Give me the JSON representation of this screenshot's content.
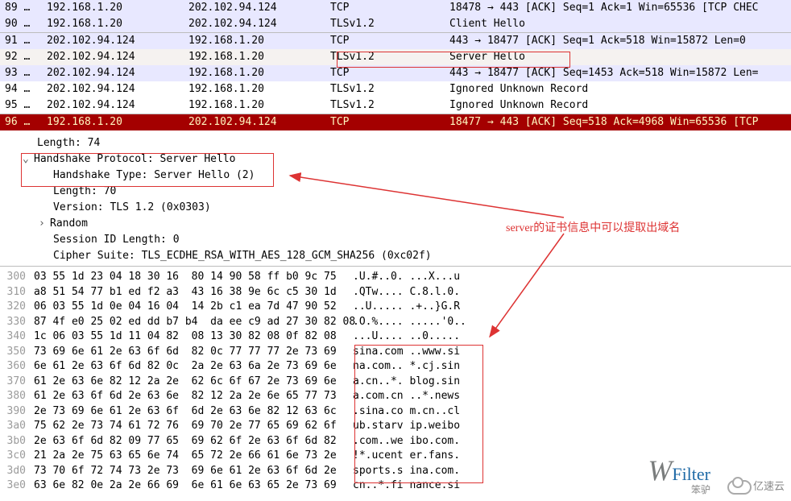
{
  "packets": [
    {
      "no": "89 …",
      "src": "192.168.1.20",
      "dst": "202.102.94.124",
      "prot": "TCP",
      "info": "18478 → 443 [ACK] Seq=1 Ack=1 Win=65536 [TCP CHEC",
      "cls": "row-tcp-lav"
    },
    {
      "no": "90 …",
      "src": "192.168.1.20",
      "dst": "202.102.94.124",
      "prot": "TLSv1.2",
      "info": "Client Hello",
      "cls": "row-tls-lav"
    },
    {
      "no": "91 …",
      "src": "202.102.94.124",
      "dst": "192.168.1.20",
      "prot": "TCP",
      "info": "443 → 18477 [ACK] Seq=1 Ack=518 Win=15872 Len=0",
      "cls": "row-tcp-lav rowsep"
    },
    {
      "no": "92 …",
      "src": "202.102.94.124",
      "dst": "192.168.1.20",
      "prot": "TLSv1.2",
      "info": "Server Hello",
      "cls": "row-sel"
    },
    {
      "no": "93 …",
      "src": "202.102.94.124",
      "dst": "192.168.1.20",
      "prot": "TCP",
      "info": "443 → 18477 [ACK] Seq=1453 Ack=518 Win=15872 Len=",
      "cls": "row-tcp-lav"
    },
    {
      "no": "94 …",
      "src": "202.102.94.124",
      "dst": "192.168.1.20",
      "prot": "TLSv1.2",
      "info": "Ignored Unknown Record",
      "cls": "row-tls-white"
    },
    {
      "no": "95 …",
      "src": "202.102.94.124",
      "dst": "192.168.1.20",
      "prot": "TLSv1.2",
      "info": "Ignored Unknown Record",
      "cls": "row-tls-white"
    },
    {
      "no": "96 …",
      "src": "192.168.1.20",
      "dst": "202.102.94.124",
      "prot": "TCP",
      "info": "18477 → 443 [ACK] Seq=518 Ack=4968 Win=65536 [TCP",
      "cls": "row-red rowsep"
    }
  ],
  "details": {
    "length": "Length: 74",
    "proto_header": "Handshake Protocol: Server Hello",
    "hs_type": "Handshake Type: Server Hello (2)",
    "length2": "Length: 70",
    "version": "Version: TLS 1.2 (0x0303)",
    "random": "Random",
    "session": "Session ID Length: 0",
    "cipher": "Cipher Suite: TLS_ECDHE_RSA_WITH_AES_128_GCM_SHA256 (0xc02f)"
  },
  "hex": [
    {
      "off": "300",
      "b": "03 55 1d 23 04 18 30 16  80 14 90 58 ff b0 9c 75",
      "a": ".U.#..0. ...X...u"
    },
    {
      "off": "310",
      "b": "a8 51 54 77 b1 ed f2 a3  43 16 38 9e 6c c5 30 1d",
      "a": ".QTw.... C.8.l.0."
    },
    {
      "off": "320",
      "b": "06 03 55 1d 0e 04 16 04  14 2b c1 ea 7d 47 90 52",
      "a": "..U..... .+..}G.R"
    },
    {
      "off": "330",
      "b": "87 4f e0 25 02 ed dd b7 b4  da ee c9 ad 27 30 82 08",
      "a": ".O.%.... .....'0.."
    },
    {
      "off": "340",
      "b": "1c 06 03 55 1d 11 04 82  08 13 30 82 08 0f 82 08",
      "a": "...U.... ..0....."
    },
    {
      "off": "350",
      "b": "73 69 6e 61 2e 63 6f 6d  82 0c 77 77 77 2e 73 69",
      "a": "sina.com ..www.si"
    },
    {
      "off": "360",
      "b": "6e 61 2e 63 6f 6d 82 0c  2a 2e 63 6a 2e 73 69 6e",
      "a": "na.com.. *.cj.sin"
    },
    {
      "off": "370",
      "b": "61 2e 63 6e 82 12 2a 2e  62 6c 6f 67 2e 73 69 6e",
      "a": "a.cn..*. blog.sin"
    },
    {
      "off": "380",
      "b": "61 2e 63 6f 6d 2e 63 6e  82 12 2a 2e 6e 65 77 73",
      "a": "a.com.cn ..*.news"
    },
    {
      "off": "390",
      "b": "2e 73 69 6e 61 2e 63 6f  6d 2e 63 6e 82 12 63 6c",
      "a": ".sina.co m.cn..cl"
    },
    {
      "off": "3a0",
      "b": "75 62 2e 73 74 61 72 76  69 70 2e 77 65 69 62 6f",
      "a": "ub.starv ip.weibo"
    },
    {
      "off": "3b0",
      "b": "2e 63 6f 6d 82 09 77 65  69 62 6f 2e 63 6f 6d 82",
      "a": ".com..we ibo.com."
    },
    {
      "off": "3c0",
      "b": "21 2a 2e 75 63 65 6e 74  65 72 2e 66 61 6e 73 2e",
      "a": "!*.ucent er.fans."
    },
    {
      "off": "3d0",
      "b": "73 70 6f 72 74 73 2e 73  69 6e 61 2e 63 6f 6d 2e",
      "a": "sports.s ina.com."
    },
    {
      "off": "3e0",
      "b": "63 6e 82 0e 2a 2e 66 69  6e 61 6e 63 65 2e 73 69",
      "a": "cn..*.fi nance.si"
    }
  ],
  "annotation": "server的证书信息中可以提取出域名",
  "logos": {
    "wfilter_w": "W",
    "wfilter_f": "Filter",
    "wfilter_sub": "笨驴",
    "yisu": "亿速云"
  }
}
